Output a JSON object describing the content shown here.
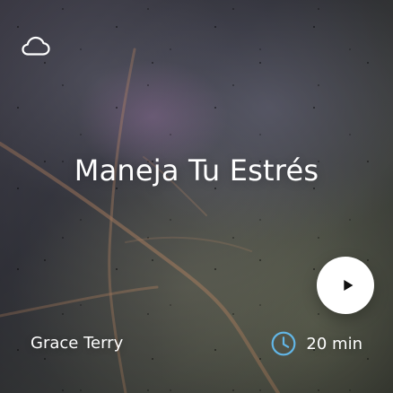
{
  "card": {
    "title": "Maneja Tu Estrés",
    "author": "Grace Terry",
    "duration": "20 min",
    "icons": {
      "download": "cloud-icon",
      "play": "play-icon",
      "duration": "clock-icon"
    },
    "colors": {
      "text": "#ffffff",
      "play_button_bg": "#ffffff",
      "play_icon": "#111111",
      "clock_accent": "#62b6e6"
    }
  }
}
